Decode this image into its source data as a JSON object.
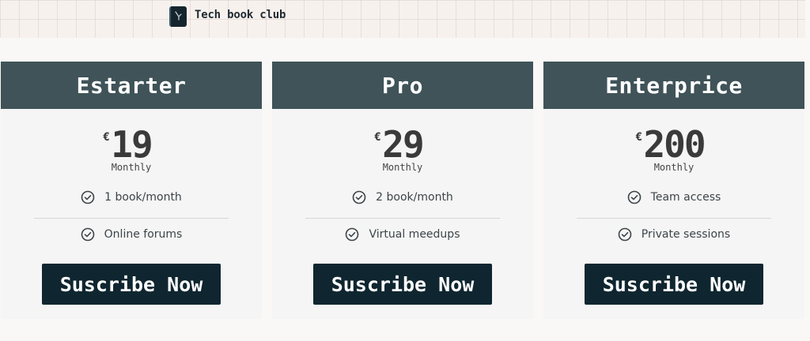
{
  "brand": {
    "name": "Tech book club"
  },
  "plans": [
    {
      "name": "Estarter",
      "currency": "€",
      "price": "19",
      "period": "Monthly",
      "features": [
        "1 book/month",
        "Online forums"
      ],
      "cta": "Suscribe Now"
    },
    {
      "name": "Pro",
      "currency": "€",
      "price": "29",
      "period": "Monthly",
      "features": [
        "2 book/month",
        "Virtual meedups"
      ],
      "cta": "Suscribe Now"
    },
    {
      "name": "Enterprice",
      "currency": "€",
      "price": "200",
      "period": "Monthly",
      "features": [
        "Team access",
        "Private sessions"
      ],
      "cta": "Suscribe Now"
    }
  ]
}
